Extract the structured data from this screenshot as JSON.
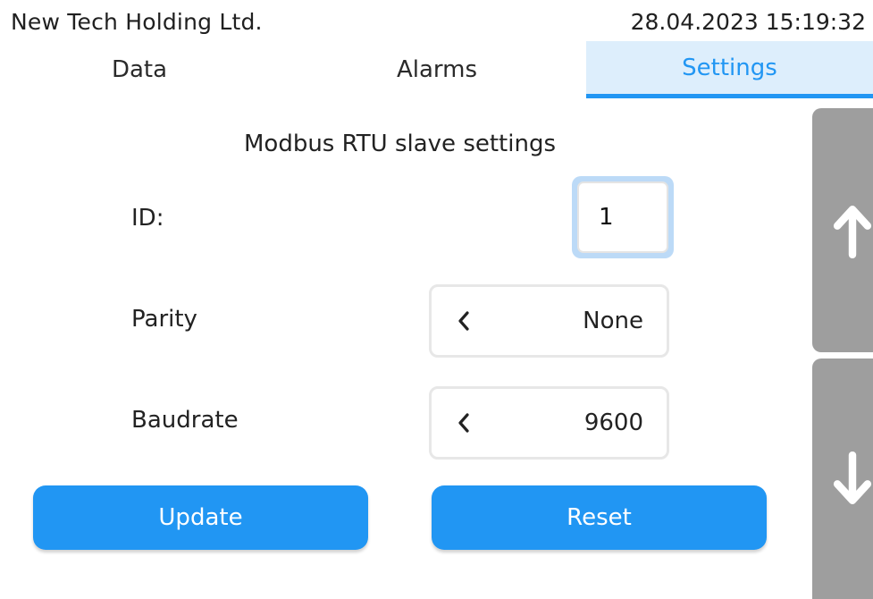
{
  "header": {
    "company": "New Tech Holding Ltd.",
    "datetime": "28.04.2023 15:19:32"
  },
  "tabs": [
    {
      "label": "Data",
      "active": false
    },
    {
      "label": "Alarms",
      "active": false
    },
    {
      "label": "Settings",
      "active": true
    }
  ],
  "settings": {
    "title": "Modbus RTU slave settings",
    "id": {
      "label": "ID:",
      "value": "1"
    },
    "parity": {
      "label": "Parity",
      "value": "None",
      "icon": "chevron-left-icon"
    },
    "baudrate": {
      "label": "Baudrate",
      "value": "9600",
      "icon": "chevron-left-icon"
    },
    "update_label": "Update",
    "reset_label": "Reset"
  },
  "scroll": {
    "up_icon": "arrow-up-icon",
    "down_icon": "arrow-down-icon"
  },
  "colors": {
    "accent": "#2196f3",
    "active_tab_bg": "#ddeefc",
    "scroll_button": "#9e9e9e",
    "input_focus": "#bcdaf7"
  }
}
